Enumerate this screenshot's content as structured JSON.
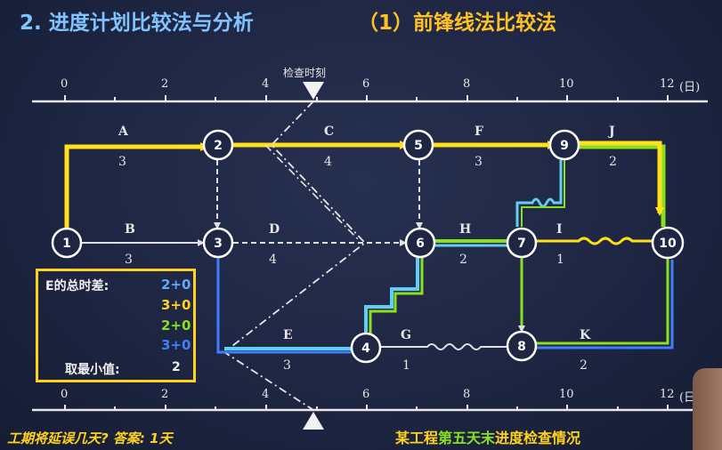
{
  "header": {
    "left_title": "2. 进度计划比较法与分析",
    "right_title": "（1）前锋线法比较法"
  },
  "timeline": {
    "ticks": [
      "0",
      "2",
      "4",
      "6",
      "8",
      "10",
      "12"
    ],
    "unit": "(日)",
    "check_label": "检查时刻"
  },
  "nodes": [
    "1",
    "2",
    "3",
    "4",
    "5",
    "6",
    "7",
    "8",
    "9",
    "10"
  ],
  "activities": [
    {
      "name": "A",
      "duration": "3"
    },
    {
      "name": "B",
      "duration": "3"
    },
    {
      "name": "C",
      "duration": "4"
    },
    {
      "name": "D",
      "duration": "4"
    },
    {
      "name": "E",
      "duration": "3"
    },
    {
      "name": "F",
      "duration": "3"
    },
    {
      "name": "G",
      "duration": "1"
    },
    {
      "name": "H",
      "duration": "2"
    },
    {
      "name": "I",
      "duration": "1"
    },
    {
      "name": "J",
      "duration": "2"
    },
    {
      "name": "K",
      "duration": "2"
    }
  ],
  "info_box": {
    "title": "E的总时差:",
    "values": [
      {
        "text": "2+0",
        "color": "#5fa8ff"
      },
      {
        "text": "3+0",
        "color": "#ffd21e"
      },
      {
        "text": "2+0",
        "color": "#8be01e"
      },
      {
        "text": "3+0",
        "color": "#3d7fff"
      }
    ],
    "min_label": "取最小值:",
    "min_value": "2"
  },
  "question": "工期将延误几天?  答案:  1天",
  "caption": {
    "part1": "某工程",
    "part2": "第五天末",
    "part3": "进度检查情况"
  },
  "colors": {
    "critical_path": "#ffe01a",
    "green_path": "#8be01e",
    "blue_path": "#3d7fff",
    "cyan_path": "#62cdf4",
    "header_left": "#7fc3ff",
    "header_right": "#ffc222"
  }
}
